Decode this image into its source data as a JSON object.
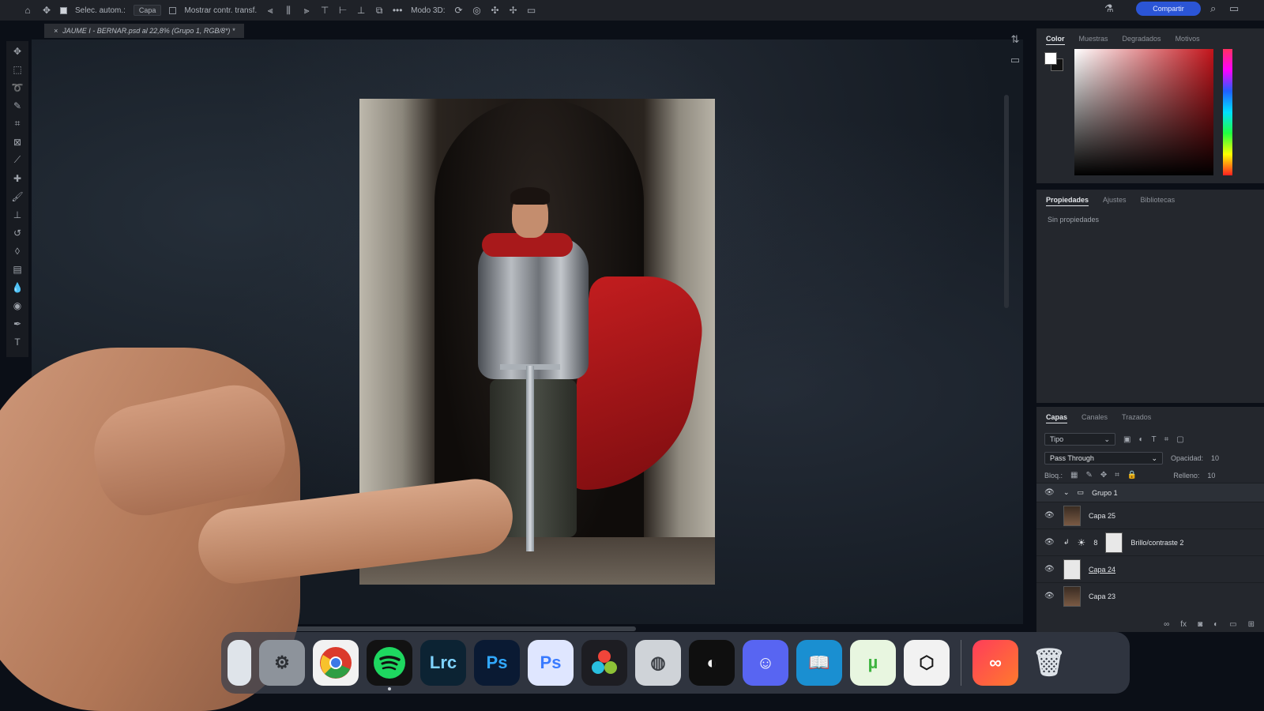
{
  "optionsbar": {
    "auto_select_label": "Selec. autom.:",
    "auto_select_value": "Capa",
    "show_transform_label": "Mostrar contr. transf.",
    "mode_3d_label": "Modo 3D:"
  },
  "share_button": "Compartir",
  "document_tab": "JAUME I - BERNAR.psd al 22,8% (Grupo 1, RGB/8*) *",
  "color_panel": {
    "tabs": [
      "Color",
      "Muestras",
      "Degradados",
      "Motivos"
    ]
  },
  "properties_panel": {
    "tabs": [
      "Propiedades",
      "Ajustes",
      "Bibliotecas"
    ],
    "empty_text": "Sin propiedades"
  },
  "layers_panel": {
    "tabs": [
      "Capas",
      "Canales",
      "Trazados"
    ],
    "filter_value": "Tipo",
    "blend_mode": "Pass Through",
    "opacity_label": "Opacidad:",
    "opacity_value": "10",
    "lock_label": "Bloq.:",
    "fill_label": "Relleno:",
    "fill_value": "10",
    "layers": [
      {
        "name": "Grupo 1"
      },
      {
        "name": "Capa 25"
      },
      {
        "name": "Brillo/contraste 2"
      },
      {
        "name": "Capa 24"
      },
      {
        "name": "Capa 23"
      }
    ]
  },
  "dock": {
    "apps": [
      {
        "name": "finder",
        "label": ""
      },
      {
        "name": "system-preferences",
        "label": ""
      },
      {
        "name": "chrome",
        "label": ""
      },
      {
        "name": "spotify",
        "label": ""
      },
      {
        "name": "lightroom-classic",
        "label": "Lrc"
      },
      {
        "name": "photoshop",
        "label": "Ps"
      },
      {
        "name": "photoshop-beta",
        "label": "Ps"
      },
      {
        "name": "davinci-resolve",
        "label": ""
      },
      {
        "name": "disk-utility",
        "label": ""
      },
      {
        "name": "app-unknown-1",
        "label": ""
      },
      {
        "name": "discord",
        "label": ""
      },
      {
        "name": "kindle",
        "label": ""
      },
      {
        "name": "utorrent",
        "label": ""
      },
      {
        "name": "blender-like",
        "label": ""
      },
      {
        "name": "creative-cloud",
        "label": ""
      },
      {
        "name": "trash",
        "label": ""
      }
    ]
  },
  "colors": {
    "app_bg": "#1f2228",
    "panel_bg": "#24272d",
    "share_blue": "#2b55d6",
    "cape_red": "#c21d1f"
  }
}
